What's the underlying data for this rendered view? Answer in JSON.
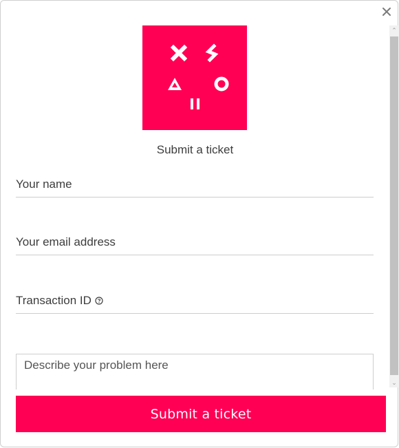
{
  "dialog": {
    "title": "Submit a ticket",
    "close_icon": "close-icon",
    "logo_icon": "brand-logo"
  },
  "form": {
    "name_placeholder": "Your name",
    "email_placeholder": "Your email address",
    "transaction_placeholder": "Transaction ID",
    "transaction_help_icon": "question-circle-icon",
    "problem_placeholder": "Describe your problem here"
  },
  "actions": {
    "submit_label": "Submit a ticket"
  },
  "colors": {
    "brand": "#ff0055",
    "border": "#cdcdcd",
    "text": "#3d3d3d"
  }
}
